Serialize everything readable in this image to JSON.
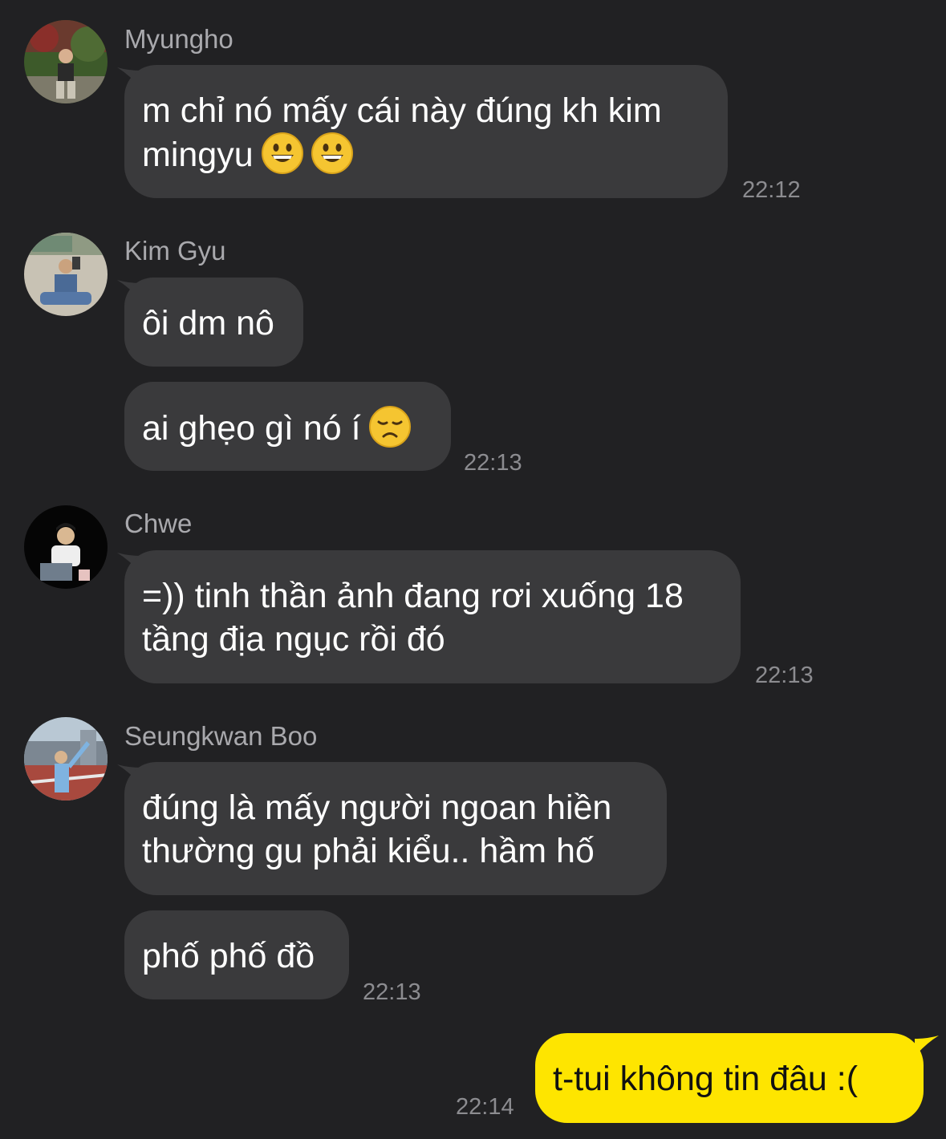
{
  "messages": [
    {
      "sender": "Myungho",
      "avatar_icon": "avatar-photo-icon",
      "lines": [
        "m chỉ nó mấy cái này đúng kh kim",
        "mingyu"
      ],
      "emojis": [
        "grinning-face-emoji",
        "grinning-face-emoji"
      ],
      "time": "22:12"
    },
    {
      "sender": "Kim Gyu",
      "avatar_icon": "avatar-photo-icon",
      "bubbles": [
        {
          "text": "ôi dm nô"
        },
        {
          "text": "ai ghẹo gì nó í",
          "emoji": "disappointed-face-emoji"
        }
      ],
      "time": "22:13"
    },
    {
      "sender": "Chwe",
      "avatar_icon": "avatar-photo-icon",
      "lines": [
        "=)) tinh thần ảnh đang rơi xuống 18",
        "tầng địa ngục rồi đó"
      ],
      "time": "22:13"
    },
    {
      "sender": "Seungkwan Boo",
      "avatar_icon": "avatar-photo-icon",
      "bubbles": [
        {
          "lines": [
            "đúng là mấy người ngoan hiền",
            "thường gu phải kiểu.. hầm hố"
          ]
        },
        {
          "text": "phố phố đồ"
        }
      ],
      "time": "22:13"
    },
    {
      "sender": "me",
      "text": "t-tui không tin đâu :(",
      "time": "22:14"
    }
  ],
  "colors": {
    "background": "#212123",
    "incoming_bubble": "#3a3a3c",
    "outgoing_bubble": "#fee500",
    "sender_name": "#a9a9ad",
    "timestamp": "#8c8c90"
  }
}
